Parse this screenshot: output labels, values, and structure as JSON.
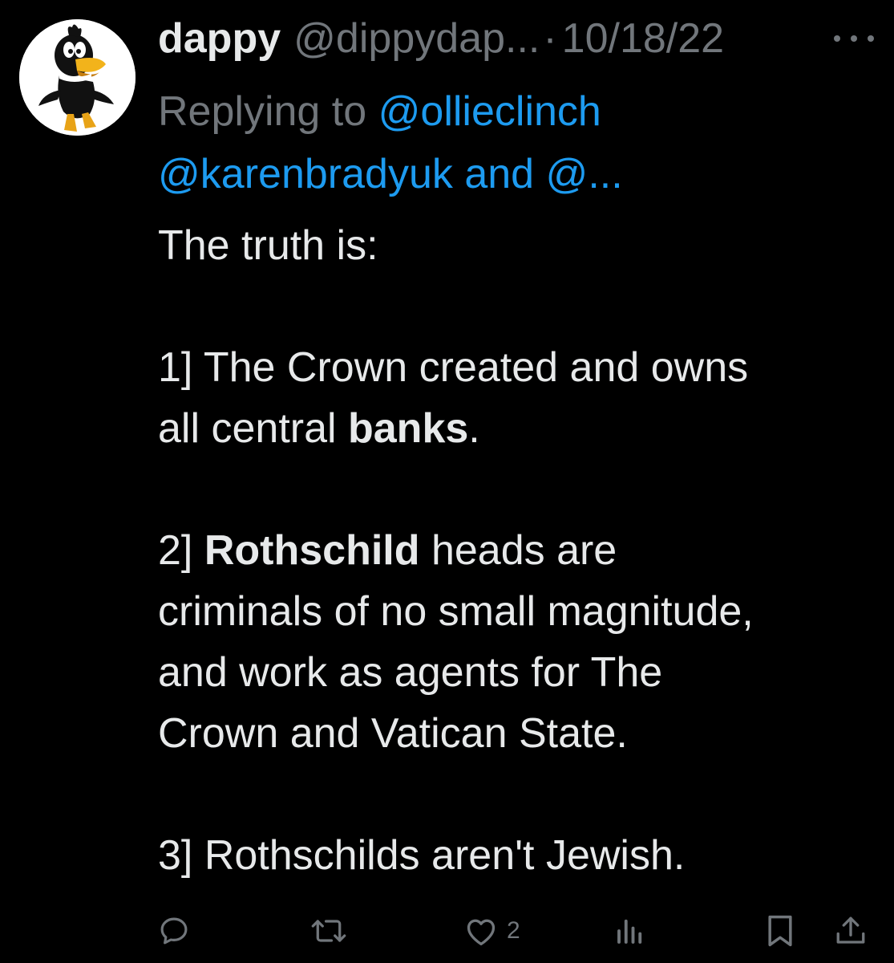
{
  "tweet": {
    "display_name": "dappy",
    "handle": "@dippydap...",
    "separator": "·",
    "date": "10/18/22",
    "replying_prefix": "Replying to",
    "replying_mention_1": "@ollieclinch",
    "replying_mention_2": "@karenbradyuk",
    "replying_and": "and",
    "replying_mention_3": "@...",
    "body": {
      "line1": "The truth is:",
      "p1_a": "1]  The Crown created and owns",
      "p1_b": "all central ",
      "p1_bold": "banks",
      "p1_end": ".",
      "p2_a": "2] ",
      "p2_bold": "Rothschild",
      "p2_b": " heads are",
      "p2_c": "criminals of no small magnitude,",
      "p2_d": "and work as agents for The",
      "p2_e": "Crown and Vatican State.",
      "p3": "3] Rothschilds aren't Jewish."
    },
    "likes_count": "2"
  },
  "icons": {
    "more": "more-dots-icon",
    "reply": "reply-icon",
    "retweet": "retweet-icon",
    "like": "heart-icon",
    "views": "views-icon",
    "bookmark": "bookmark-icon",
    "share": "share-icon"
  },
  "colors": {
    "background": "#000000",
    "text": "#e7e9ea",
    "secondary": "#71767b",
    "link": "#1d9bf0"
  }
}
